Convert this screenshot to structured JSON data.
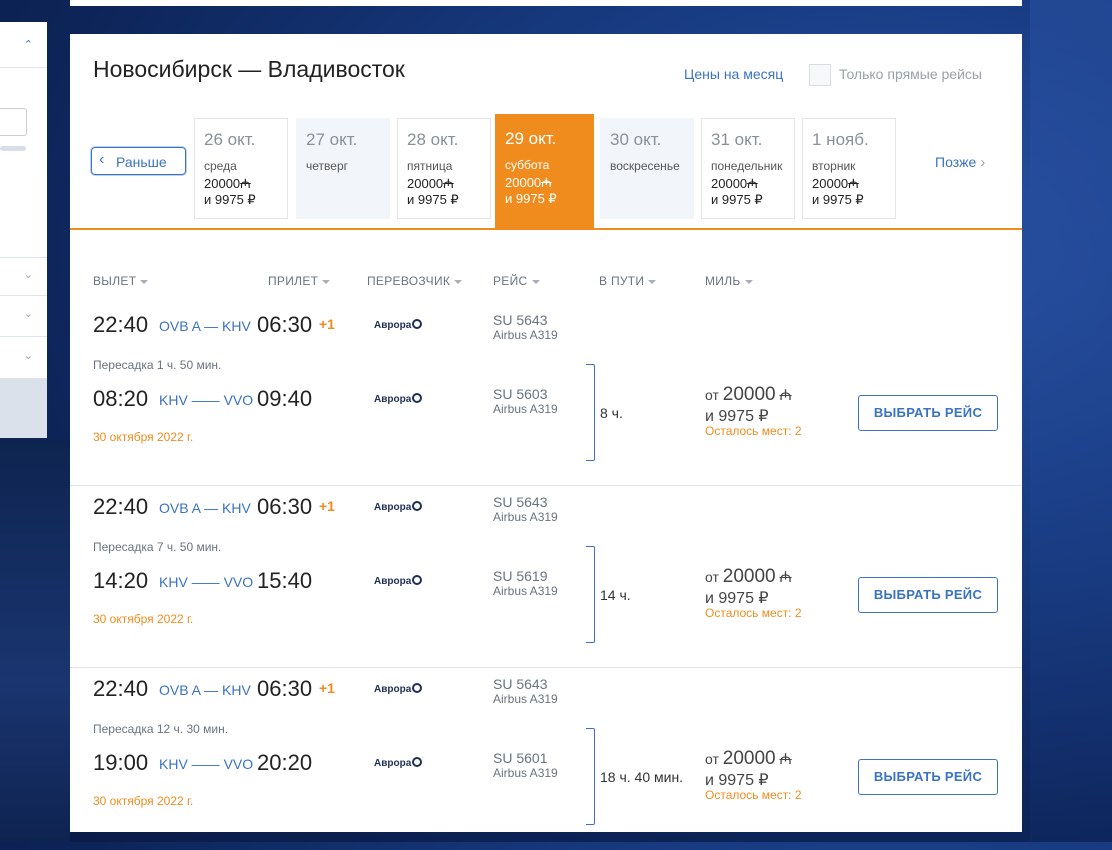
{
  "colors": {
    "accent": "#f08c1e",
    "link": "#3a73c4"
  },
  "left_panel": {
    "icons": [
      "chevron-up-icon",
      "chevron-down-icon",
      "chevron-down-icon",
      "chevron-down-icon"
    ]
  },
  "header": {
    "route": "Новосибирск — Владивосток",
    "month_prices_link": "Цены на месяц",
    "direct_only_label": "Только прямые рейсы",
    "direct_only_checked": false
  },
  "date_nav": {
    "earlier": "Раньше",
    "later": "Позже",
    "dates": [
      {
        "date": "26 окт.",
        "weekday": "среда",
        "miles": "20000",
        "miles_sym": "₼",
        "rub": "и 9975 ₽",
        "selected": false,
        "empty": false
      },
      {
        "date": "27 окт.",
        "weekday": "четверг",
        "miles": "",
        "miles_sym": "",
        "rub": "",
        "selected": false,
        "empty": true
      },
      {
        "date": "28 окт.",
        "weekday": "пятница",
        "miles": "20000",
        "miles_sym": "₼",
        "rub": "и 9975 ₽",
        "selected": false,
        "empty": false
      },
      {
        "date": "29 окт.",
        "weekday": "суббота",
        "miles": "20000",
        "miles_sym": "₼",
        "rub": "и 9975 ₽",
        "selected": true,
        "empty": false
      },
      {
        "date": "30 окт.",
        "weekday": "воскресенье",
        "miles": "",
        "miles_sym": "",
        "rub": "",
        "selected": false,
        "empty": true
      },
      {
        "date": "31 окт.",
        "weekday": "понедельник",
        "miles": "20000",
        "miles_sym": "₼",
        "rub": "и 9975 ₽",
        "selected": false,
        "empty": false
      },
      {
        "date": "1 нояб.",
        "weekday": "вторник",
        "miles": "20000",
        "miles_sym": "₼",
        "rub": "и 9975 ₽",
        "selected": false,
        "empty": false
      }
    ]
  },
  "columns": {
    "departure": "ВЫЛЕТ",
    "arrival": "ПРИЛЕТ",
    "carrier": "ПЕРЕВОЗЧИК",
    "flight": "РЕЙС",
    "duration": "В ПУТИ",
    "miles": "МИЛЬ"
  },
  "flights": [
    {
      "leg1": {
        "dep": "22:40",
        "route": "OVB A — KHV",
        "arr": "06:30",
        "next_day": "+1",
        "carrier": "Аврора",
        "flight_no": "SU 5643",
        "aircraft": "Airbus A319"
      },
      "layover": "Пересадка 1 ч. 50 мин.",
      "leg2": {
        "dep": "08:20",
        "route": "KHV —— VVO",
        "arr": "09:40",
        "carrier": "Аврора",
        "flight_no": "SU 5603",
        "aircraft": "Airbus A319"
      },
      "date": "30 октября 2022 г.",
      "duration": "8 ч.",
      "price_prefix": "от",
      "miles": "20000",
      "miles_sym": "₼",
      "rub": "и 9975 ₽",
      "seats": "Осталось мест: 2",
      "button": "ВЫБРАТЬ РЕЙС"
    },
    {
      "leg1": {
        "dep": "22:40",
        "route": "OVB A — KHV",
        "arr": "06:30",
        "next_day": "+1",
        "carrier": "Аврора",
        "flight_no": "SU 5643",
        "aircraft": "Airbus A319"
      },
      "layover": "Пересадка 7 ч. 50 мин.",
      "leg2": {
        "dep": "14:20",
        "route": "KHV —— VVO",
        "arr": "15:40",
        "carrier": "Аврора",
        "flight_no": "SU 5619",
        "aircraft": "Airbus A319"
      },
      "date": "30 октября 2022 г.",
      "duration": "14 ч.",
      "price_prefix": "от",
      "miles": "20000",
      "miles_sym": "₼",
      "rub": "и 9975 ₽",
      "seats": "Осталось мест: 2",
      "button": "ВЫБРАТЬ РЕЙС"
    },
    {
      "leg1": {
        "dep": "22:40",
        "route": "OVB A — KHV",
        "arr": "06:30",
        "next_day": "+1",
        "carrier": "Аврора",
        "flight_no": "SU 5643",
        "aircraft": "Airbus A319"
      },
      "layover": "Пересадка 12 ч. 30 мин.",
      "leg2": {
        "dep": "19:00",
        "route": "KHV —— VVO",
        "arr": "20:20",
        "carrier": "Аврора",
        "flight_no": "SU 5601",
        "aircraft": "Airbus A319"
      },
      "date": "30 октября 2022 г.",
      "duration": "18 ч. 40 мин.",
      "price_prefix": "от",
      "miles": "20000",
      "miles_sym": "₼",
      "rub": "и 9975 ₽",
      "seats": "Осталось мест: 2",
      "button": "ВЫБРАТЬ РЕЙС"
    }
  ]
}
